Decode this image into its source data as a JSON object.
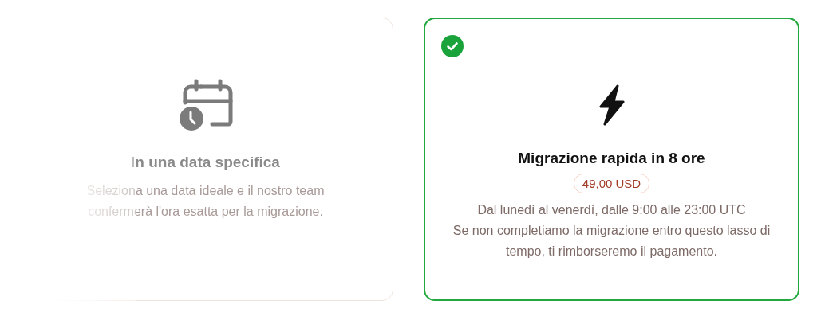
{
  "options": [
    {
      "selected": false,
      "title": "In una data specifica",
      "description": [
        "Seleziona una data ideale e il nostro team confermerà l'ora esatta per la migrazione."
      ]
    },
    {
      "selected": true,
      "title": "Migrazione rapida in 8 ore",
      "price": "49,00 USD",
      "description": [
        "Dal lunedì al venerdì, dalle 9:00 alle 23:00 UTC",
        "Se non completiamo la migrazione entro questo lasso di tempo, ti rimborseremo il pagamento."
      ]
    }
  ]
}
